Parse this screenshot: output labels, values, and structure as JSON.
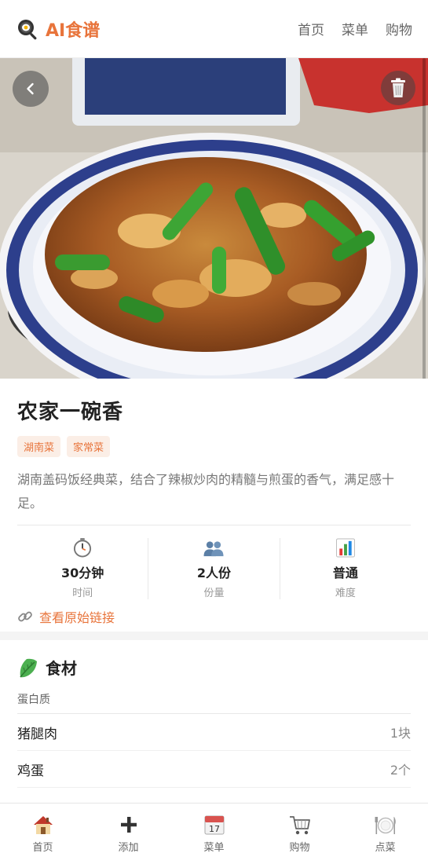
{
  "header": {
    "app_title": "AI食谱",
    "brand_icon": "frying-pan-icon",
    "nav": [
      "首页",
      "菜单",
      "购物"
    ]
  },
  "hero": {
    "back_icon": "chevron-left-icon",
    "delete_icon": "trash-icon"
  },
  "recipe": {
    "title": "农家一碗香",
    "tags": [
      "湖南菜",
      "家常菜"
    ],
    "description": "湖南盖码饭经典菜，结合了辣椒炒肉的精髓与煎蛋的香气，满足感十足。",
    "stats": [
      {
        "icon": "stopwatch-icon",
        "value": "30分钟",
        "label": "时间"
      },
      {
        "icon": "people-icon",
        "value": "2人份",
        "label": "份量"
      },
      {
        "icon": "bar-chart-icon",
        "value": "普通",
        "label": "难度"
      }
    ],
    "source_link": "查看原始链接",
    "source_icon": "link-icon"
  },
  "ingredients": {
    "title": "食材",
    "icon": "lettuce-icon",
    "groups": [
      {
        "name": "蛋白质",
        "items": [
          {
            "name": "猪腿肉",
            "qty": "1块"
          },
          {
            "name": "鸡蛋",
            "qty": "2个"
          }
        ]
      }
    ]
  },
  "tabbar": [
    {
      "icon": "house-icon",
      "label": "首页"
    },
    {
      "icon": "plus-icon",
      "label": "添加"
    },
    {
      "icon": "calendar-icon",
      "label": "菜单"
    },
    {
      "icon": "shopping-cart-icon",
      "label": "购物"
    },
    {
      "icon": "plate-cutlery-icon",
      "label": "点菜"
    }
  ],
  "colors": {
    "accent": "#e8743b",
    "tag_bg": "#fbeee6"
  }
}
